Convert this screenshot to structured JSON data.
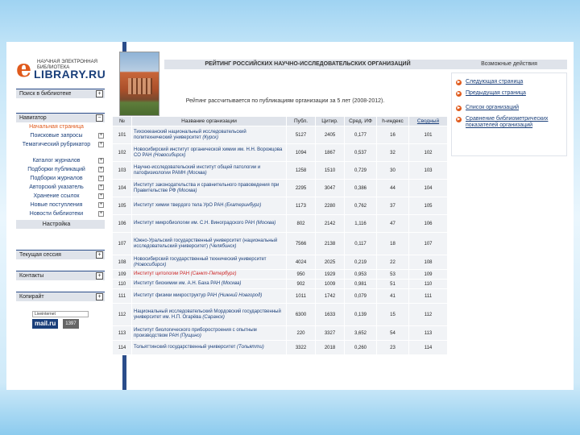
{
  "logo": {
    "top_text": "НАУЧНАЯ ЭЛЕКТРОННАЯ БИБЛИОТЕКА",
    "e_letter": "e",
    "main_text": "LIBRARY.RU"
  },
  "sidebar": {
    "search_head": "Поиск в библиотеке",
    "nav_head": "Навигатор",
    "items": [
      {
        "label": "Начальная страница",
        "active": true
      },
      {
        "label": "Поисковые запросы"
      },
      {
        "label": "Тематический рубрикатор",
        "tall": true
      },
      {
        "label": "Каталог журналов"
      },
      {
        "label": "Подборки публикаций"
      },
      {
        "label": "Подборки журналов"
      },
      {
        "label": "Авторский указатель"
      },
      {
        "label": "Хранение ссылок"
      },
      {
        "label": "Новые поступления"
      },
      {
        "label": "Новости библиотеки"
      }
    ],
    "settings": "Настройка",
    "session_head": "Текущая сессия",
    "contacts_head": "Контакты",
    "counter_head": "Копирайт",
    "badge_top": "Liveinternet",
    "badge_mail": "mail.ru",
    "badge_num": "1397"
  },
  "main": {
    "title": "РЕЙТИНГ РОССИЙСКИХ НАУЧНО-ИССЛЕДОВАТЕЛЬСКИХ ОРГАНИЗАЦИЙ",
    "subtitle": "Рейтинг рассчитывается по публикациям организации за 5 лет (2008-2012).",
    "columns": [
      "№",
      "Название организации",
      "Публ.",
      "Цитир.",
      "Сред. ИФ",
      "h-индекс",
      "Сводный"
    ],
    "rows": [
      {
        "n": "101",
        "name": "Тихоокеанский национальный исследовательский политехнический университет",
        "city": "(Курск)",
        "pub": "5127",
        "cit": "2405",
        "if": "0,177",
        "h": "16",
        "sum": "101",
        "cls": "r2"
      },
      {
        "n": "102",
        "name": "Новосибирский институт органической химии им. Н.Н. Ворожцова СО РАН",
        "city": "(Новосибирск)",
        "pub": "1094",
        "cit": "1867",
        "if": "0,537",
        "h": "32",
        "sum": "102",
        "cls": "r2"
      },
      {
        "n": "103",
        "name": "Научно-исследовательский институт общей патологии и патофизиологии РАМН",
        "city": "(Москва)",
        "pub": "1258",
        "cit": "1510",
        "if": "0,729",
        "h": "30",
        "sum": "103",
        "cls": "r2"
      },
      {
        "n": "104",
        "name": "Институт законодательства и сравнительного правоведения при Правительстве РФ",
        "city": "(Москва)",
        "pub": "2295",
        "cit": "3047",
        "if": "0,386",
        "h": "44",
        "sum": "104",
        "cls": "r2"
      },
      {
        "n": "105",
        "name": "Институт химии твердого тела УрО РАН",
        "city": "(Екатеринбург)",
        "pub": "1173",
        "cit": "2280",
        "if": "0,762",
        "h": "37",
        "sum": "105",
        "cls": "r2"
      },
      {
        "n": "106",
        "name": "Институт микробиологии им. С.Н. Виноградского РАН",
        "city": "(Москва)",
        "pub": "802",
        "cit": "2142",
        "if": "1,116",
        "h": "47",
        "sum": "106",
        "cls": "r2"
      },
      {
        "n": "107",
        "name": "Южно-Уральский государственный университет (национальный исследовательский университет)",
        "city": "(Челябинск)",
        "pub": "7566",
        "cit": "2138",
        "if": "0,117",
        "h": "18",
        "sum": "107",
        "cls": "r1"
      },
      {
        "n": "108",
        "name": "Новосибирский государственный технический университет",
        "city": "(Новосибирск)",
        "pub": "4024",
        "cit": "2025",
        "if": "0,219",
        "h": "22",
        "sum": "108",
        "cls": "r4"
      },
      {
        "n": "109",
        "name": "Институт цитологии РАН",
        "city": "(Санкт-Петербург)",
        "pub": "950",
        "cit": "1929",
        "if": "0,953",
        "h": "53",
        "sum": "109",
        "cls": "r3",
        "hl": true
      },
      {
        "n": "110",
        "name": "Институт биохимии им. А.Н. Баха РАН",
        "city": "(Москва)",
        "pub": "902",
        "cit": "1009",
        "if": "0,981",
        "h": "51",
        "sum": "110",
        "cls": "r3"
      },
      {
        "n": "111",
        "name": "Институт физики микроструктур РАН",
        "city": "(Нижний Новгород)",
        "pub": "1011",
        "cit": "1742",
        "if": "0,079",
        "h": "41",
        "sum": "111",
        "cls": "r4"
      },
      {
        "n": "112",
        "name": "Национальный исследовательский Мордовский государственный университет им. Н.П. Огарёва",
        "city": "(Саранск)",
        "pub": "6300",
        "cit": "1633",
        "if": "0,139",
        "h": "15",
        "sum": "112",
        "cls": "r1"
      },
      {
        "n": "113",
        "name": "Институт биологического приборостроения с опытным производством РАН",
        "city": "(Пущино)",
        "pub": "220",
        "cit": "3327",
        "if": "3,652",
        "h": "54",
        "sum": "113",
        "cls": "r4"
      },
      {
        "n": "114",
        "name": "Тольяттинский государственный университет",
        "city": "(Тольятти)",
        "pub": "3322",
        "cit": "2018",
        "if": "0,260",
        "h": "23",
        "sum": "114",
        "cls": "r4"
      }
    ]
  },
  "right": {
    "head": "Возможные действия",
    "actions": [
      "Следующая страница",
      "Предыдущая страница",
      "Список организаций",
      "Сравнение библиометрических показателей организаций"
    ]
  }
}
